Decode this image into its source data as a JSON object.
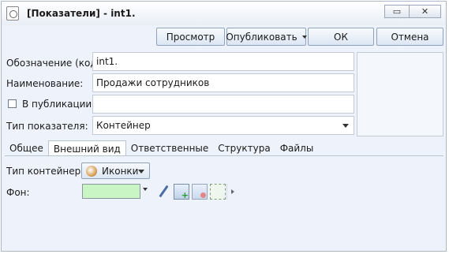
{
  "window": {
    "title": "[Показатели] - int1.",
    "buttons": {
      "restore": "▭",
      "close": "✕"
    }
  },
  "toolbar": {
    "preview": "Просмотр",
    "publish": "Опубликовать",
    "ok": "ОК",
    "cancel": "Отмена"
  },
  "form": {
    "code_label": "Обозначение (код):",
    "code_value": "int1.",
    "name_label": "Наименование:",
    "name_value": "Продажи сотрудников",
    "in_publication_label": "В публикации:",
    "in_publication_checked": false,
    "in_publication_value": "",
    "type_label": "Тип показателя:",
    "type_value": "Контейнер"
  },
  "tabs": [
    "Общее",
    "Внешний вид",
    "Ответственные",
    "Структура",
    "Файлы"
  ],
  "active_tab": "Внешний вид",
  "appearance": {
    "container_type_label": "Тип контейнера:",
    "container_type_value": "Иконки",
    "background_label": "Фон:",
    "background_color": "#c9f5c5"
  },
  "icons": {
    "app": "document-icon",
    "container_type": "icons-sphere-icon",
    "pen": "pen-icon",
    "image_add": "image-add-icon",
    "image_delete": "image-delete-icon",
    "fit": "fit-image-icon"
  }
}
